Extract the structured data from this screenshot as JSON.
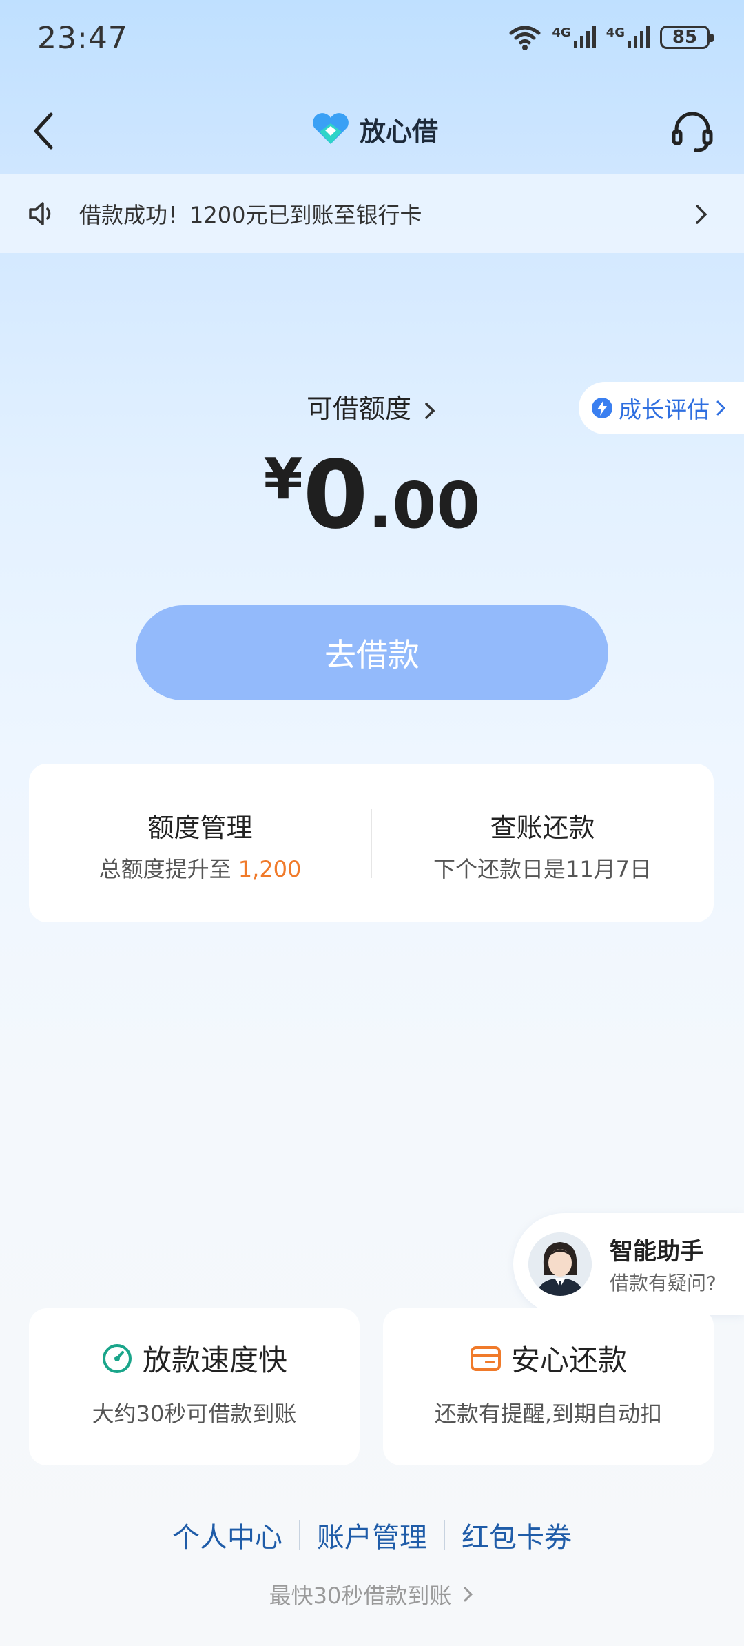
{
  "status_bar": {
    "time": "23:47",
    "battery": "85",
    "signal1": "4G",
    "signal2": "4G"
  },
  "nav": {
    "title": "放心借"
  },
  "notice": {
    "text": "借款成功！1200元已到账至银行卡"
  },
  "quota": {
    "label": "可借额度",
    "currency": "¥",
    "amount_int": "0",
    "amount_dec": ".00",
    "growth_badge": "成长评估"
  },
  "borrow_button": "去借款",
  "management": {
    "left": {
      "title": "额度管理",
      "sub_prefix": "总额度提升至 ",
      "sub_value": "1,200"
    },
    "right": {
      "title": "查账还款",
      "sub": "下个还款日是11月7日"
    }
  },
  "assistant": {
    "title": "智能助手",
    "sub": "借款有疑问?"
  },
  "features": [
    {
      "title": "放款速度快",
      "sub": "大约30秒可借款到账",
      "icon": "speed-gauge-icon"
    },
    {
      "title": "安心还款",
      "sub": "还款有提醒,到期自动扣",
      "icon": "card-icon"
    }
  ],
  "links": [
    {
      "label": "个人中心"
    },
    {
      "label": "账户管理"
    },
    {
      "label": "红包卡券"
    }
  ],
  "footer_tip": "最快30秒借款到账",
  "colors": {
    "accent_blue": "#2f6fe0",
    "button_blue": "#93bafb",
    "orange": "#f07a2a",
    "green": "#1aa58a",
    "link_blue": "#1f5ca8"
  }
}
